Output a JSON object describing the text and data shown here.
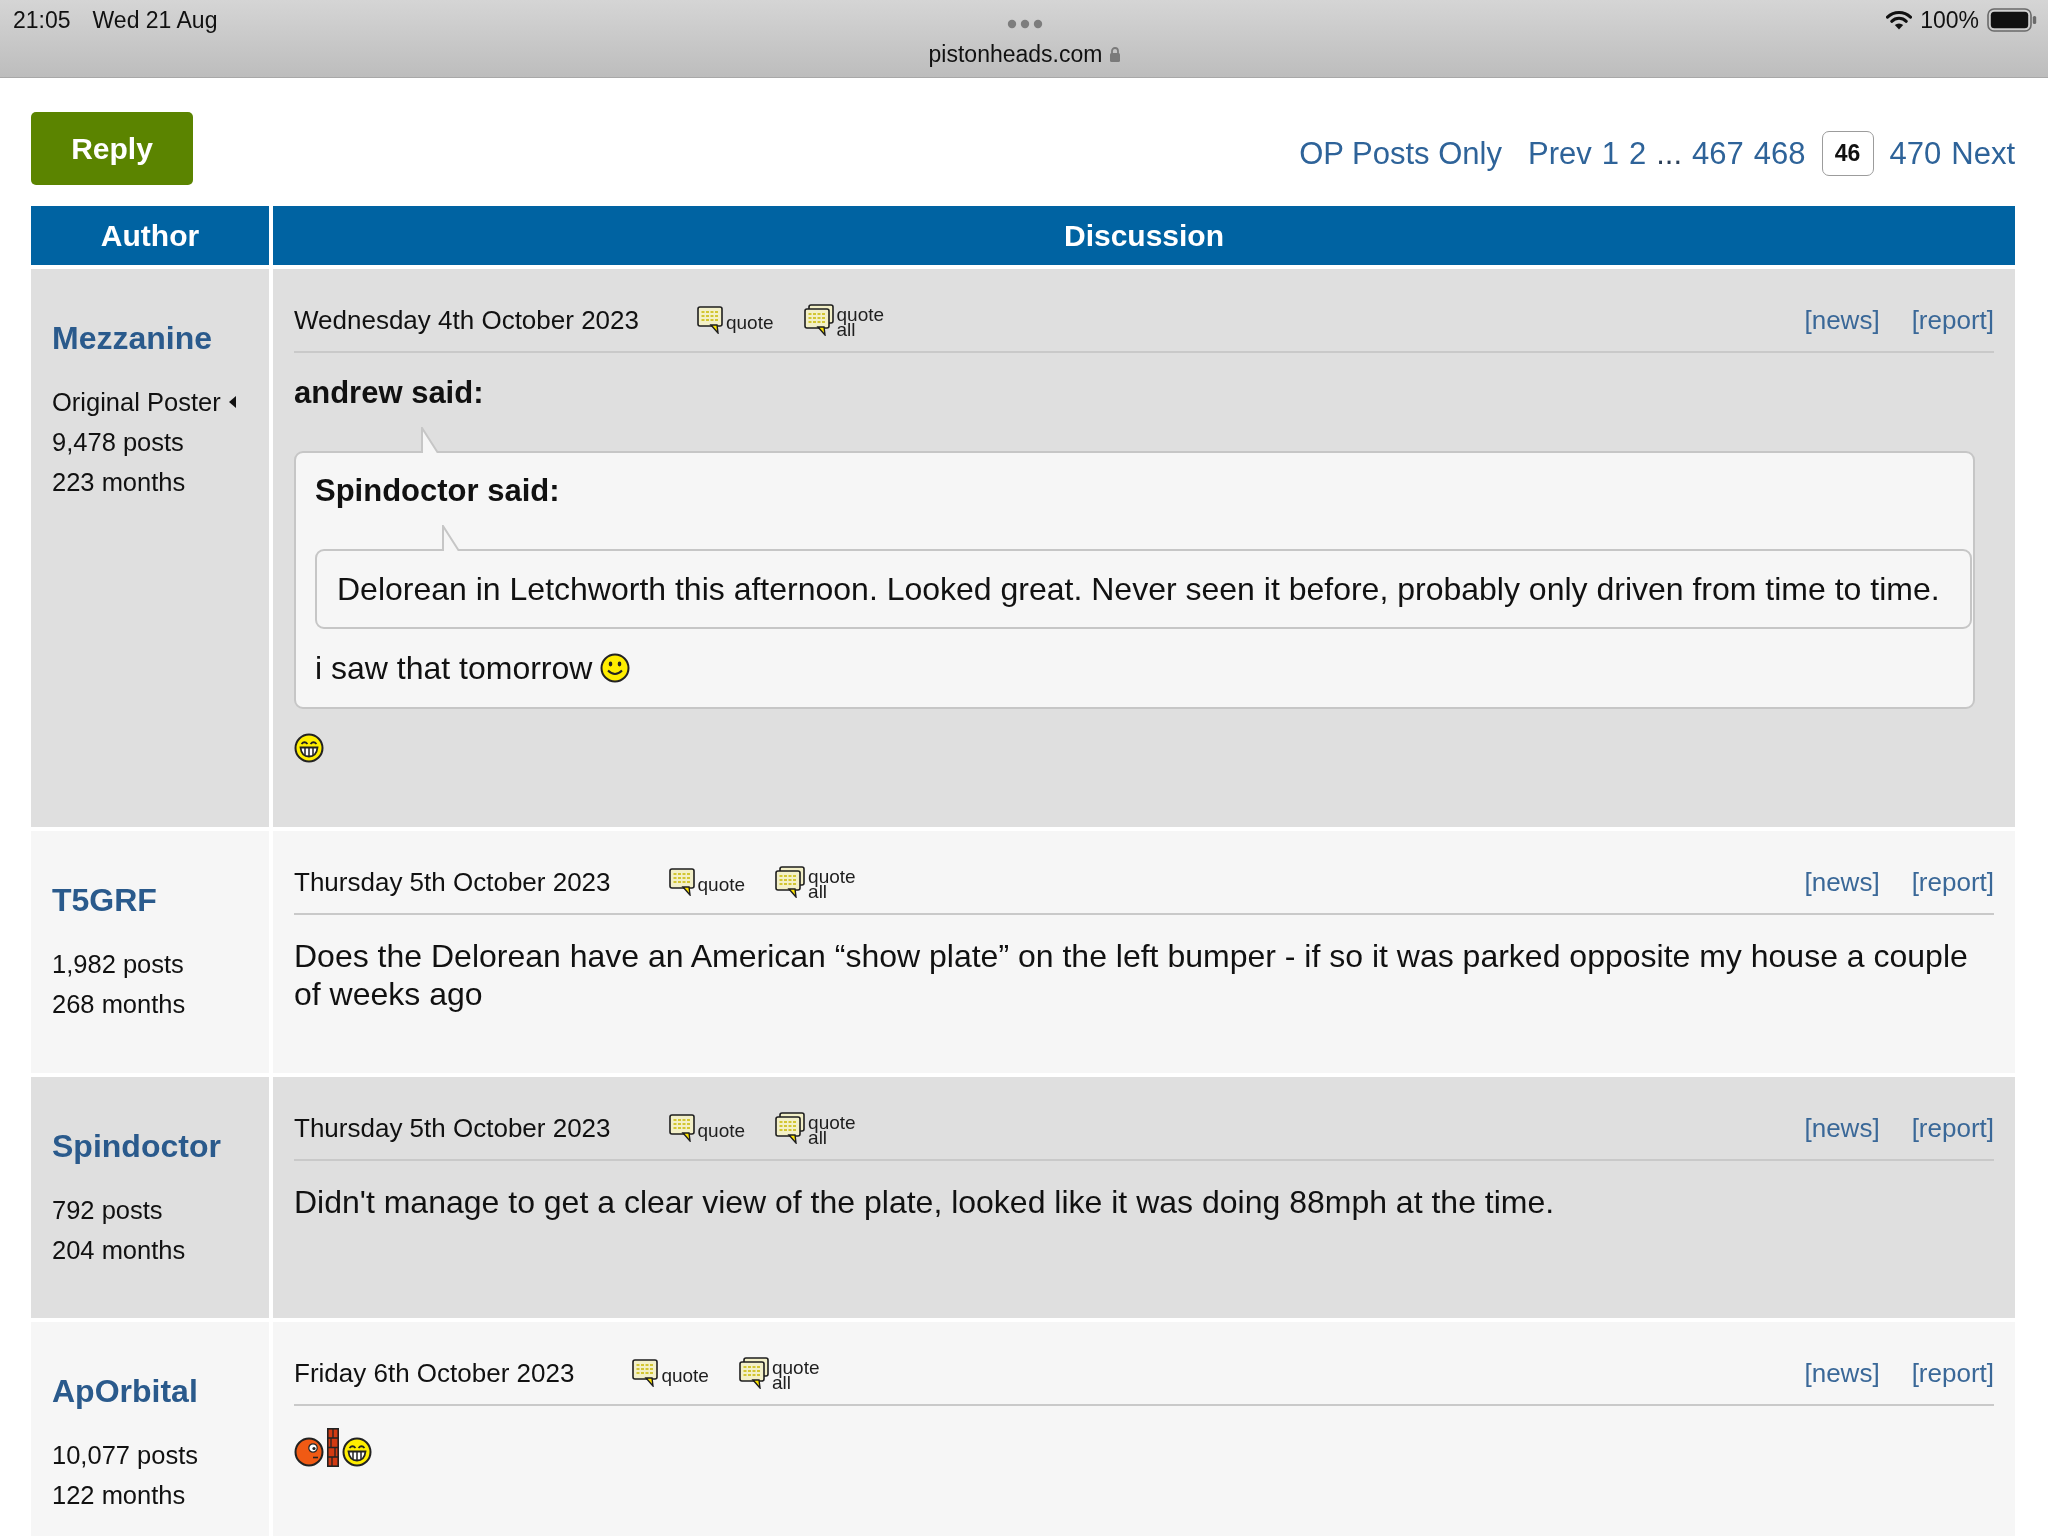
{
  "status_bar": {
    "time": "21:05",
    "date": "Wed 21 Aug",
    "address": "pistonheads.com",
    "battery": "100%"
  },
  "toolbar": {
    "reply_button": "Reply",
    "op_posts_link": "OP Posts Only",
    "pagination": [
      {
        "kind": "link",
        "label": "Prev"
      },
      {
        "kind": "link",
        "label": "1"
      },
      {
        "kind": "link",
        "label": "2"
      },
      {
        "kind": "gap",
        "label": "..."
      },
      {
        "kind": "link",
        "label": "467"
      },
      {
        "kind": "link",
        "label": "468"
      },
      {
        "kind": "input",
        "value": "46"
      },
      {
        "kind": "link",
        "label": "470"
      },
      {
        "kind": "link",
        "label": "Next"
      }
    ]
  },
  "table": {
    "columns": [
      "Author",
      "Discussion"
    ],
    "posts": [
      {
        "author": {
          "name": "Mezzanine",
          "role": "Original Poster",
          "posts": "9,478 posts",
          "months": "223 months"
        },
        "date": "Wednesday 4th October 2023",
        "actions": [
          {
            "kind": "single",
            "label": "quote"
          },
          {
            "kind": "all",
            "label": "quote all"
          }
        ],
        "links": [
          "[news]",
          "[report]"
        ],
        "content": [
          {
            "kind": "quote",
            "author": "andrew said:",
            "content": [
              {
                "kind": "quote",
                "author": "Spindoctor said:",
                "content": [
                  {
                    "kind": "paragraph",
                    "text": "Delorean in Letchworth this afternoon. Looked great. Never seen it before, probably only driven from time to time."
                  }
                ]
              },
              {
                "kind": "paragraph",
                "text": "i saw that tomorrow",
                "emoticons": [
                  {
                    "kind": "smile"
                  }
                ]
              }
            ]
          },
          {
            "kind": "paragraph",
            "emoticons": [
              {
                "kind": "grin"
              }
            ]
          }
        ]
      },
      {
        "author": {
          "name": "T5GRF",
          "posts": "1,982 posts",
          "months": "268 months"
        },
        "date": "Thursday 5th October 2023",
        "actions": [
          {
            "kind": "single",
            "label": "quote"
          },
          {
            "kind": "all",
            "label": "quote all"
          }
        ],
        "links": [
          "[news]",
          "[report]"
        ],
        "content": [
          {
            "kind": "paragraph",
            "text": "Does the Delorean have an American “show plate” on the left bumper - if so it was parked opposite my house a couple of weeks ago"
          }
        ]
      },
      {
        "author": {
          "name": "Spindoctor",
          "posts": "792 posts",
          "months": "204 months"
        },
        "date": "Thursday 5th October 2023",
        "actions": [
          {
            "kind": "single",
            "label": "quote"
          },
          {
            "kind": "all",
            "label": "quote all"
          }
        ],
        "links": [
          "[news]",
          "[report]"
        ],
        "content": [
          {
            "kind": "paragraph",
            "text": "Didn't manage to get a clear view of the plate, looked like it was doing 88mph at the time."
          }
        ]
      },
      {
        "author": {
          "name": "ApOrbital",
          "posts": "10,077 posts",
          "months": "122 months"
        },
        "date": "Friday 6th October 2023",
        "actions": [
          {
            "kind": "single",
            "label": "quote"
          },
          {
            "kind": "all",
            "label": "quote all"
          }
        ],
        "links": [
          "[news]",
          "[report]"
        ],
        "content": [
          {
            "kind": "paragraph",
            "emoticons": [
              {
                "kind": "ball"
              },
              {
                "kind": "wall"
              },
              {
                "kind": "grin"
              }
            ]
          }
        ]
      }
    ]
  }
}
